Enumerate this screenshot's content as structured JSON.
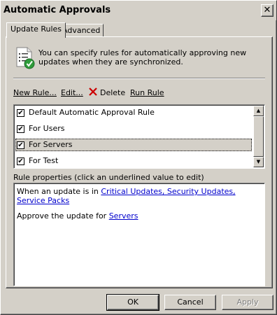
{
  "window": {
    "title": "Automatic Approvals"
  },
  "tabs": [
    {
      "label": "Update Rules",
      "active": true
    },
    {
      "label": "Advanced",
      "active": false
    }
  ],
  "info": {
    "icon": "document-checkmark-icon",
    "text": "You can specify rules for automatically approving new updates when they are synchronized."
  },
  "toolbar": {
    "new_rule": "New Rule...",
    "edit": "Edit...",
    "delete": "Delete",
    "run_rule": "Run Rule"
  },
  "rules": [
    {
      "label": "Default Automatic Approval Rule",
      "checked": true,
      "selected": false
    },
    {
      "label": "For Users",
      "checked": true,
      "selected": false
    },
    {
      "label": "For Servers",
      "checked": true,
      "selected": true
    },
    {
      "label": "For Test",
      "checked": true,
      "selected": false
    }
  ],
  "properties": {
    "label": "Rule properties (click an underlined value to edit)",
    "line1_prefix": "When an update is in ",
    "line1_link": "Critical Updates, Security Updates, Service Packs",
    "line2_prefix": "Approve the update for ",
    "line2_link": "Servers"
  },
  "buttons": {
    "ok": "OK",
    "cancel": "Cancel",
    "apply": "Apply"
  },
  "colors": {
    "face": "#d4d0c8",
    "link": "#0000cc",
    "delete_x": "#cc0000"
  }
}
